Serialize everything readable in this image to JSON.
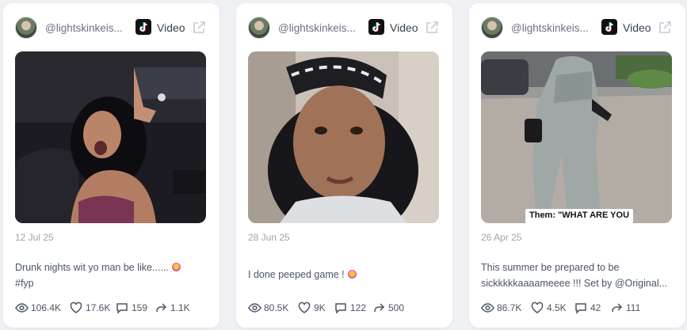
{
  "cards": [
    {
      "username": "@lightskinkeis...",
      "platform_label": "Video",
      "date": "12 Jul 25",
      "description_lines": [
        "Drunk nights wit yo man be like......",
        "#fyp"
      ],
      "stats": {
        "views": "106.4K",
        "likes": "17.6K",
        "comments": "159",
        "shares": "1.1K"
      }
    },
    {
      "username": "@lightskinkeis...",
      "platform_label": "Video",
      "date": "28 Jun 25",
      "description_lines": [
        "I done peeped game !"
      ],
      "stats": {
        "views": "80.5K",
        "likes": "9K",
        "comments": "122",
        "shares": "500"
      }
    },
    {
      "username": "@lightskinkeis...",
      "platform_label": "Video",
      "date": "26 Apr 25",
      "overlay_caption": "Them: \"WHAT ARE YOU",
      "description_lines": [
        "This summer be prepared to be",
        "sickkkkkaaaameeee !!! Set by @Original..."
      ],
      "stats": {
        "views": "86.7K",
        "likes": "4.5K",
        "comments": "42",
        "shares": "111"
      }
    }
  ],
  "icons": {
    "platform": "tiktok-icon",
    "external": "external-link-icon",
    "views": "eye-icon",
    "likes": "heart-icon",
    "comments": "comment-icon",
    "shares": "share-icon"
  },
  "colors": {
    "page_bg": "#eef0f4",
    "card_bg": "#ffffff",
    "muted_text": "#9ca3af",
    "body_text": "#4b5563"
  }
}
